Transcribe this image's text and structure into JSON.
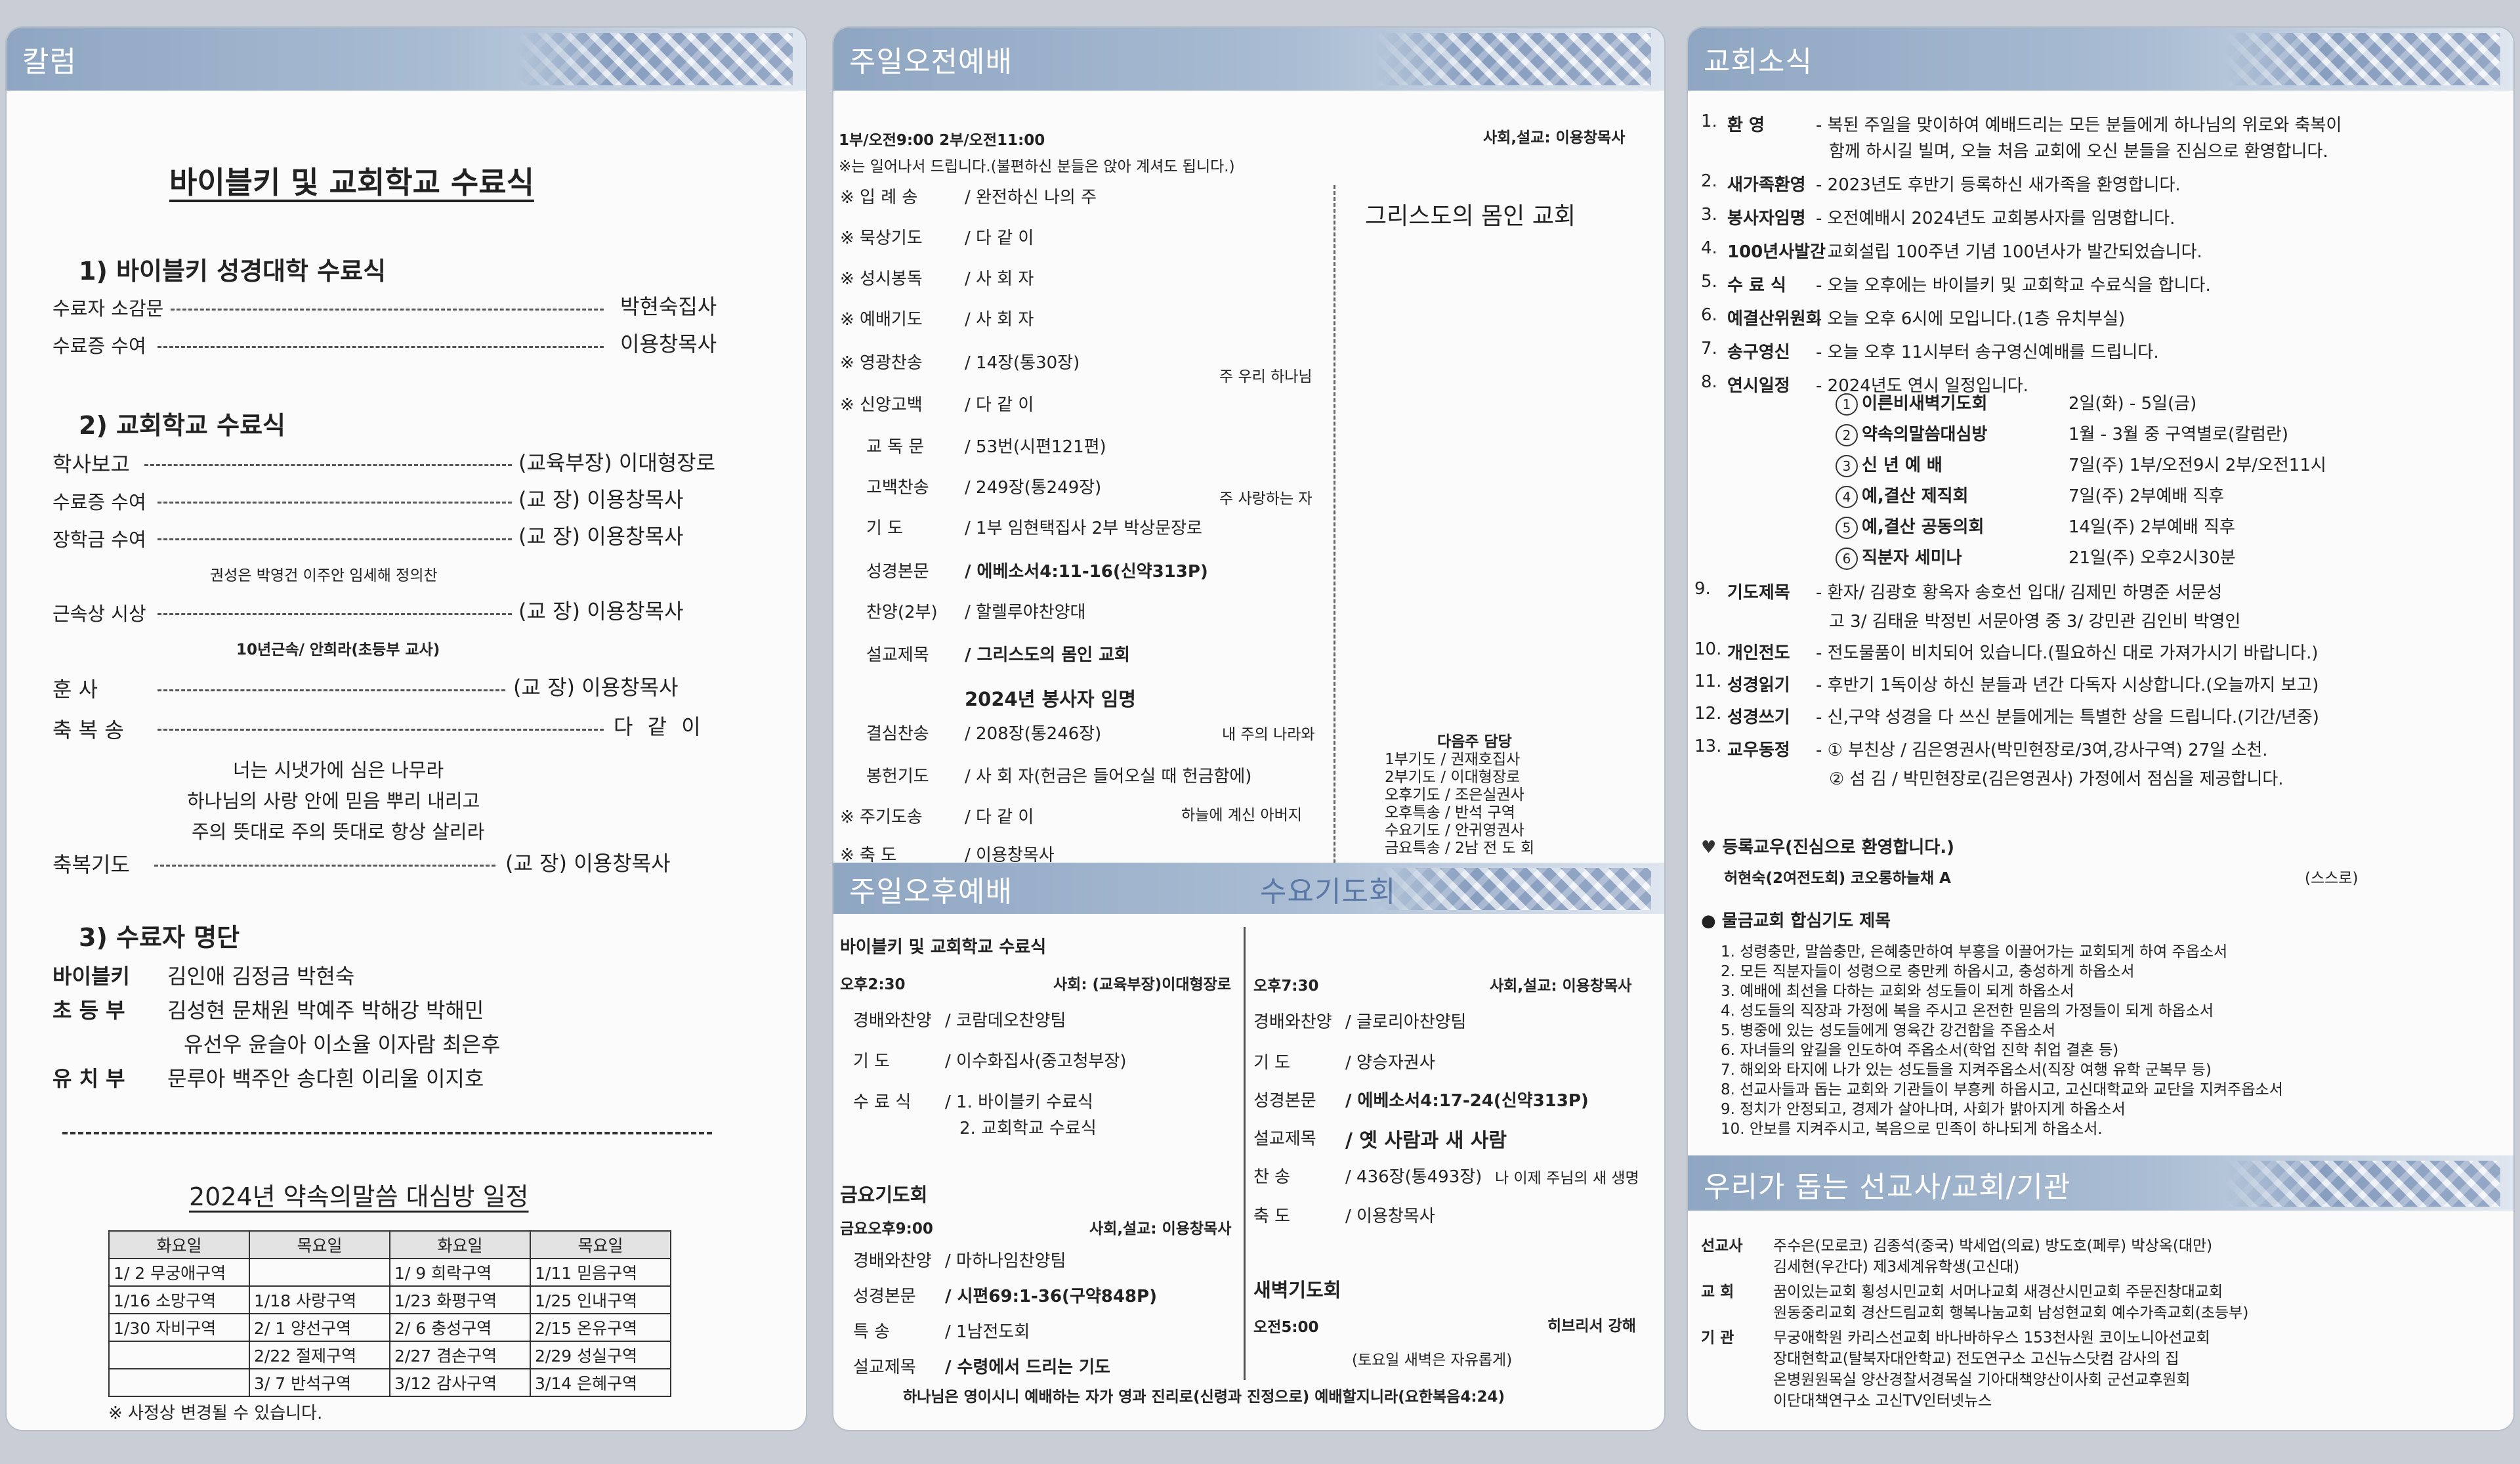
{
  "col1": {
    "header": "칼럼",
    "title": "바이블키 및 교회학교 수료식",
    "sec1": {
      "title": "1) 바이블키 성경대학 수료식",
      "rows": [
        {
          "label": "수료자 소감문",
          "value": "박현숙집사"
        },
        {
          "label": "수료증 수여",
          "value": "이용창목사"
        }
      ]
    },
    "sec2": {
      "title": "2) 교회학교 수료식",
      "rows": [
        {
          "label": "학사보고",
          "value": "(교육부장) 이대형장로"
        },
        {
          "label": "수료증 수여",
          "value": "(교     장) 이용창목사"
        },
        {
          "label": "장학금 수여",
          "value": "(교     장) 이용창목사"
        },
        {
          "label": "근속상 시상",
          "value": "(교     장) 이용창목사"
        },
        {
          "label": "훈     사",
          "value": "(교     장) 이용창목사"
        },
        {
          "label": "축 복 송",
          "value": "다 같 이"
        },
        {
          "label": "축복기도",
          "value": "(교     장) 이용창목사"
        }
      ],
      "note1": "권성은 박영건 이주안 임세해 정의찬",
      "note2": "10년근속/ 안희라(초등부 교사)",
      "song": [
        "너는 시냇가에 심은 나무라",
        "하나님의 사랑 안에 믿음 뿌리 내리고",
        "주의 뜻대로 주의 뜻대로 항상 살리라"
      ]
    },
    "sec3": {
      "title": "3) 수료자 명단",
      "rows": [
        {
          "label": "바이블키",
          "value": "김인애  김정금  박현숙"
        },
        {
          "label": "초 등 부",
          "value": "김성현  문채원  박예주  박해강  박해민"
        },
        {
          "label": "",
          "value": "유선우  윤슬아  이소율  이자람  최은후"
        },
        {
          "label": "유 치 부",
          "value": "문루아  백주안  송다흰  이리울  이지호"
        }
      ]
    },
    "schedule": {
      "title": "2024년  약속의말씀  대심방 일정",
      "headers": [
        "화요일",
        "목요일",
        "화요일",
        "목요일"
      ],
      "rows": [
        [
          "1/ 2  무궁애구역",
          "",
          "1/ 9  희락구역",
          "1/11  믿음구역"
        ],
        [
          "1/16  소망구역",
          "1/18  사랑구역",
          "1/23  화평구역",
          "1/25  인내구역"
        ],
        [
          "1/30  자비구역",
          "2/ 1  양선구역",
          "2/ 6  충성구역",
          "2/15  온유구역"
        ],
        [
          "",
          "2/22  절제구역",
          "2/27  겸손구역",
          "2/29  성실구역"
        ],
        [
          "",
          "3/ 7  반석구역",
          "3/12  감사구역",
          "3/14  은혜구역"
        ]
      ],
      "note": "※ 사정상 변경될 수 있습니다."
    }
  },
  "col2": {
    "header": "주일오전예배",
    "times": "1부/오전9:00   2부/오전11:00",
    "host": "사회,설교: 이용창목사",
    "notice": "※는 일어나서 드립니다.(불편하신 분들은 앉아 계셔도 됩니다.)",
    "sermon_title_side": "그리스도의 몸인 교회",
    "order": [
      {
        "item": "※  입 례 송",
        "detail": "/  완전하신 나의 주"
      },
      {
        "item": "※  묵상기도",
        "detail": "/  다 같 이"
      },
      {
        "item": "※  성시봉독",
        "detail": "/  사 회 자"
      },
      {
        "item": "※  예배기도",
        "detail": "/  사 회 자"
      },
      {
        "item": "※  영광찬송",
        "detail": "/  14장(통30장)"
      },
      {
        "item": "※  신앙고백",
        "detail": "/  다 같 이"
      },
      {
        "item": "교 독 문",
        "detail": "/  53번(시편121편)"
      },
      {
        "item": "고백찬송",
        "detail": "/  249장(통249장)"
      },
      {
        "item": "기     도",
        "detail": "/  1부  임현택집사     2부  박상문장로"
      },
      {
        "item": "성경본문",
        "detail": "/  에베소서4:11-16(신약313P)"
      },
      {
        "item": "찬양(2부)",
        "detail": "/  할렐루야찬양대"
      },
      {
        "item": "설교제목",
        "detail": "/  그리스도의 몸인 교회"
      },
      {
        "item": "결심찬송",
        "detail": "/  208장(통246장)"
      },
      {
        "item": "봉헌기도",
        "detail": "/  사 회 자(헌금은 들어오실 때 헌금함에)"
      },
      {
        "item": "※  주기도송",
        "detail": "/  다 같 이"
      },
      {
        "item": "※  축     도",
        "detail": "/  이용창목사"
      }
    ],
    "subtitle": "2024년 봉사자 임명",
    "hymn_notes": [
      "주 우리 하나님",
      "주 사랑하는 자",
      "내 주의 나라와",
      "하늘에 계신 아버지"
    ],
    "next_week": {
      "title": "다음주  담당",
      "rows": [
        "1부기도 / 권재호집사",
        "2부기도 / 이대형장로",
        "오후기도 / 조은실권사",
        "오후특송 / 반석  구역",
        "수요기도 / 안귀영권사",
        "금요특송 / 2남 전 도 회"
      ]
    },
    "afternoon": {
      "header": "주일오후예배",
      "title": "바이블키 및 교회학교 수료식",
      "time": "오후2:30",
      "host": "사회: (교육부장)이대형장로",
      "rows": [
        {
          "item": "경배와찬양",
          "detail": "/  코람데오찬양팀"
        },
        {
          "item": "기     도",
          "detail": "/  이수화집사(중고청부장)"
        },
        {
          "item": "수 료 식",
          "detail": "/  1. 바이블키 수료식"
        },
        {
          "item": "",
          "detail": "2. 교회학교 수료식"
        }
      ]
    },
    "friday": {
      "title": "금요기도회",
      "time": "금요오후9:00",
      "host": "사회,설교: 이용창목사",
      "rows": [
        {
          "item": "경배와찬양",
          "detail": "/  마하나임찬양팀"
        },
        {
          "item": "성경본문",
          "detail": "/  시편69:1-36(구약848P)"
        },
        {
          "item": "특     송",
          "detail": "/  1남전도회"
        },
        {
          "item": "설교제목",
          "detail": "/  수령에서 드리는 기도"
        }
      ]
    },
    "wednesday": {
      "header": "수요기도회",
      "time": "오후7:30",
      "host": "사회,설교: 이용창목사",
      "rows": [
        {
          "item": "경배와찬양",
          "detail": "/  글로리아찬양팀"
        },
        {
          "item": "기     도",
          "detail": "/  양승자권사"
        },
        {
          "item": "성경본문",
          "detail": "/  에베소서4:17-24(신약313P)"
        },
        {
          "item": "설교제목",
          "detail": "/  옛 사람과 새 사람"
        },
        {
          "item": "찬     송",
          "detail": "/  436장(통493장)"
        },
        {
          "item": "축     도",
          "detail": "/  이용창목사"
        }
      ],
      "hymn_note": "나 이제 주님의 새 생명"
    },
    "dawn": {
      "title": "새벽기도회",
      "time": "오전5:00",
      "host": "히브리서 강해",
      "note": "(토요일 새벽은 자유롭게)"
    },
    "footer_verse": "하나님은 영이시니 예배하는 자가 영과 진리로(신령과 진정으로) 예배할지니라(요한복음4:24)"
  },
  "col3": {
    "header": "교회소식",
    "news": [
      {
        "no": "1.",
        "title": "환     영",
        "text": "- 복된 주일을 맞이하여 예배드리는 모든 분들에게 하나님의 위로와 축복이",
        "text2": "함께 하시길 빌며, 오늘 처음 교회에 오신 분들을 진심으로 환영합니다."
      },
      {
        "no": "2.",
        "title": "새가족환영",
        "text": "- 2023년도 후반기 등록하신 새가족을 환영합니다."
      },
      {
        "no": "3.",
        "title": "봉사자임명",
        "text": "- 오전예배시 2024년도 교회봉사자를 임명합니다."
      },
      {
        "no": "4.",
        "title": "100년사발간",
        "text": "- 교회설립 100주년 기념 100년사가 발간되었습니다."
      },
      {
        "no": "5.",
        "title": "수 료 식",
        "text": "- 오늘 오후에는 바이블키 및 교회학교 수료식을 합니다."
      },
      {
        "no": "6.",
        "title": "예결산위원회",
        "text": "- 오늘 오후 6시에 모입니다.(1층 유치부실)"
      },
      {
        "no": "7.",
        "title": "송구영신",
        "text": "- 오늘 오후 11시부터 송구영신예배를 드립니다."
      },
      {
        "no": "8.",
        "title": "연시일정",
        "text": "- 2024년도 연시 일정입니다."
      }
    ],
    "yearly": [
      {
        "n": "1",
        "name": "이른비새벽기도회",
        "when": "2일(화) - 5일(금)"
      },
      {
        "n": "2",
        "name": "약속의말씀대심방",
        "when": "1월 - 3월 중 구역별로(칼럼란)"
      },
      {
        "n": "3",
        "name": "신   년   예   배",
        "when": "7일(주) 1부/오전9시   2부/오전11시"
      },
      {
        "n": "4",
        "name": "예,결산  제직회",
        "when": "7일(주) 2부예배 직후"
      },
      {
        "n": "5",
        "name": "예,결산  공동의회",
        "when": "14일(주) 2부예배 직후"
      },
      {
        "n": "6",
        "name": "직분자  세미나",
        "when": "21일(주) 오후2시30분"
      }
    ],
    "news2": [
      {
        "no": "9.",
        "title": "기도제목",
        "text": "- 환자/ 김광호 황옥자 송호선           입대/ 김제민 하명준 서문성",
        "text2": "고 3/ 김태윤 박정빈 서문아영      중 3/ 강민관 김인비 박영인"
      },
      {
        "no": "10.",
        "title": "개인전도",
        "text": "- 전도물품이 비치되어 있습니다.(필요하신 대로 가져가시기 바랍니다.)"
      },
      {
        "no": "11.",
        "title": "성경읽기",
        "text": "- 후반기 1독이상 하신 분들과 년간 다독자 시상합니다.(오늘까지 보고)"
      },
      {
        "no": "12.",
        "title": "성경쓰기",
        "text": "- 신,구약 성경을 다 쓰신 분들에게는 특별한 상을 드립니다.(기간/년중)"
      },
      {
        "no": "13.",
        "title": "교우동정",
        "text": "- ① 부친상 / 김은영권사(박민현장로/3여,강사구역) 27일 소천.",
        "text2": "② 섬 김 / 박민현장로(김은영권사) 가정에서 점심을 제공합니다."
      }
    ],
    "registered": {
      "title": "등록교우(진심으로 환영합니다.)",
      "name": "허현숙(2여전도회) 코오롱하늘채 A",
      "note": "(스스로)"
    },
    "prayer": {
      "title": "물금교회 합심기도 제목",
      "items": [
        "1. 성령충만, 말씀충만, 은혜충만하여 부흥을 이끌어가는 교회되게 하여 주옵소서",
        "2. 모든 직분자들이 성령으로 충만케 하옵시고, 충성하게 하옵소서",
        "3. 예배에 최선을 다하는 교회와 성도들이 되게 하옵소서",
        "4. 성도들의 직장과 가정에 복을 주시고 온전한 믿음의 가정들이 되게 하옵소서",
        "5. 병중에 있는 성도들에게 영육간 강건함을 주옵소서",
        "6. 자녀들의 앞길을 인도하여 주옵소서(학업 진학 취업 결혼 등)",
        "7. 해외와 타지에 나가 있는 성도들을 지켜주옵소서(직장 여행 유학 군복무 등)",
        "8. 선교사들과 돕는 교회와 기관들이 부흥케 하옵시고, 고신대학교와 교단을 지켜주옵소서",
        "9. 정치가 안정되고, 경제가 살아나며, 사회가 밝아지게 하옵소서",
        "10. 안보를 지켜주시고, 복음으로 민족이 하나되게 하옵소서."
      ]
    },
    "mission": {
      "header": "우리가 돕는 선교사/교회/기관",
      "rows": [
        {
          "label": "선교사",
          "lines": [
            "주수은(모로코)  김종석(중국)  박세업(의료)  방도호(페루)  박상옥(대만)",
            "김세현(우간다)  제3세계유학생(고신대)"
          ]
        },
        {
          "label": "교     회",
          "lines": [
            "꿈이있는교회  횡성시민교회  서머나교회  새경산시민교회  주문진창대교회",
            "원동중리교회  경산드림교회  행복나눔교회  남성현교회  예수가족교회(초등부)"
          ]
        },
        {
          "label": "기     관",
          "lines": [
            "무궁애학원  카리스선교회  바나바하우스  153천사원  코이노니아선교회",
            "장대현학교(탈북자대안학교)   전도연구소  고신뉴스닷컴  감사의 집",
            "온병원원목실  양산경찰서경목실  기아대책양산이사회  군선교후원회",
            "이단대책연구소  고신TV인터넷뉴스"
          ]
        }
      ]
    }
  }
}
